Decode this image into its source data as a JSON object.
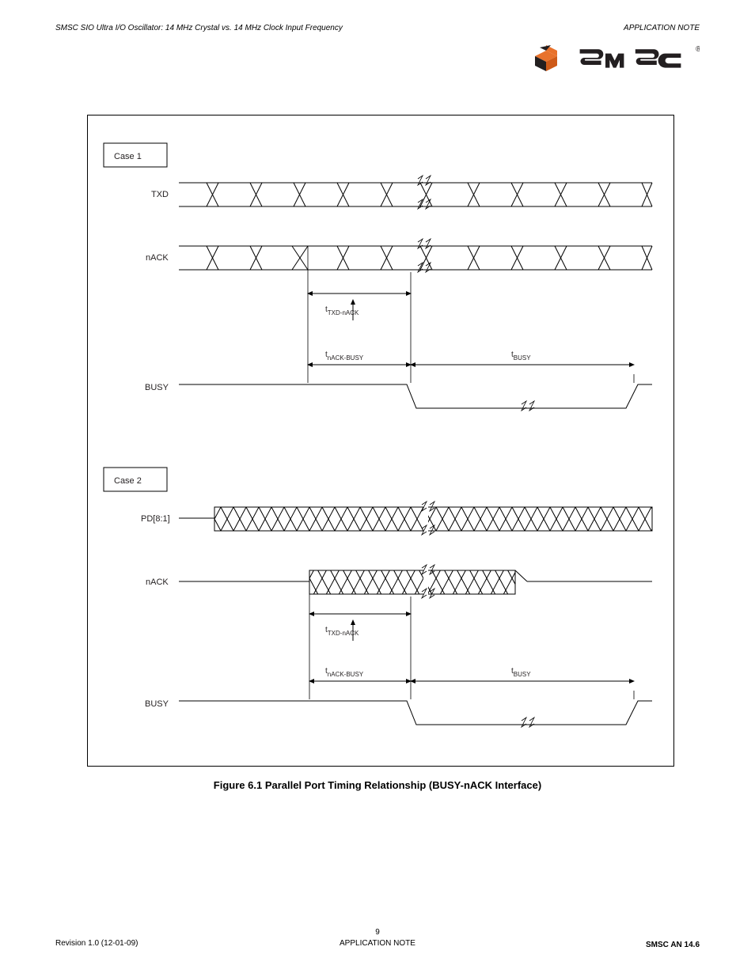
{
  "header": {
    "left": "SMSC SIO Ultra I/O Oscillator: 14 MHz Crystal vs. 14 MHz Clock Input Frequency",
    "right": "APPLICATION NOTE"
  },
  "logo": {
    "brand": "smsc",
    "reg": "®"
  },
  "figure": {
    "case1": {
      "label": "Case 1",
      "signals": {
        "txd": "TXD",
        "nack": "nACK",
        "busy": "BUSY"
      },
      "timing": {
        "t_txd_nack": {
          "symbol": "t",
          "sub": "TXD-nACK"
        },
        "t_nack_busy": {
          "symbol": "t",
          "sub": "nACK-BUSY"
        },
        "t_busy": {
          "symbol": "t",
          "sub": "BUSY"
        }
      }
    },
    "case2": {
      "label": "Case 2",
      "signals": {
        "pd": "PD[8:1]",
        "nack": "nACK",
        "busy": "BUSY"
      },
      "timing": {
        "t_txd_nack": {
          "symbol": "t",
          "sub": "TXD-nACK"
        },
        "t_nack_busy": {
          "symbol": "t",
          "sub": "nACK-BUSY"
        },
        "t_busy": {
          "symbol": "t",
          "sub": "BUSY"
        }
      }
    }
  },
  "caption": "Figure 6.1 Parallel Port Timing Relationship (BUSY-nACK Interface)",
  "footer": {
    "rev": "Revision 1.0 (12-01-09)",
    "page": "9",
    "type": "APPLICATION NOTE",
    "docno": "SMSC AN 14.6"
  }
}
